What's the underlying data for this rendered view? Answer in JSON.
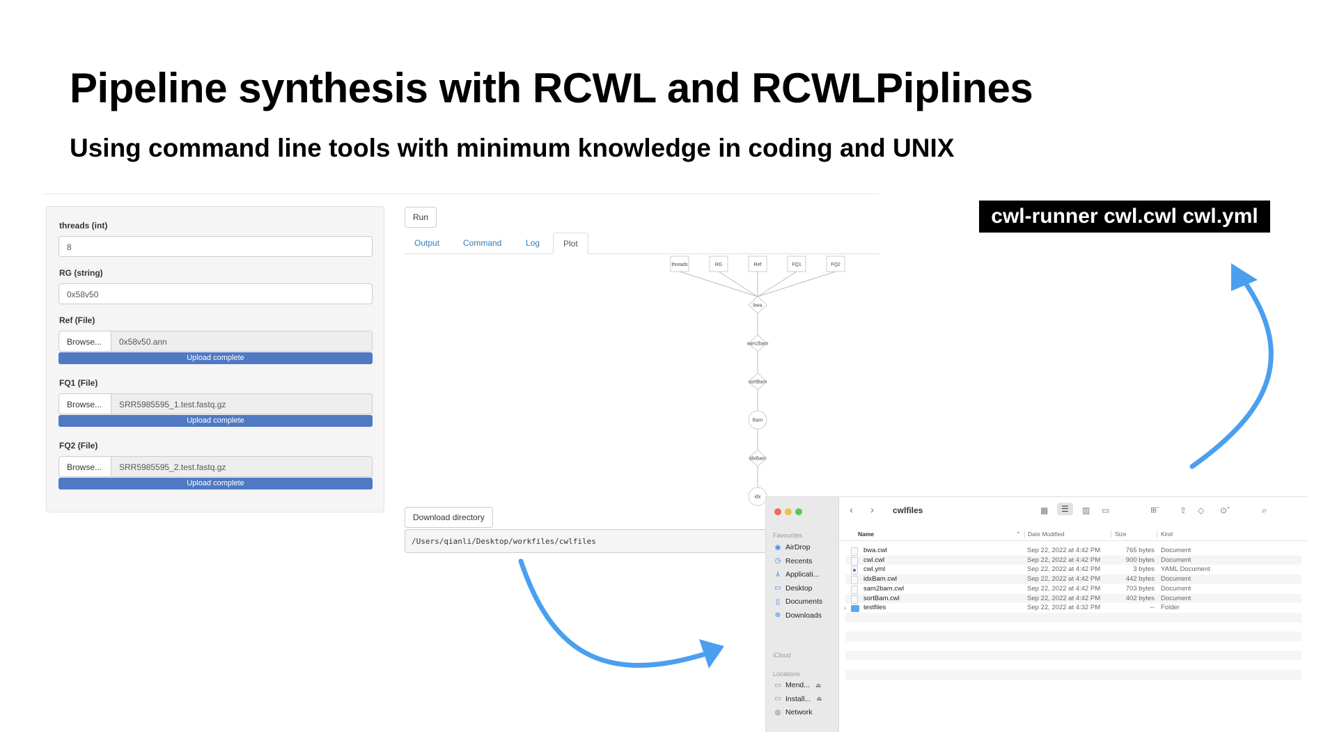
{
  "slide": {
    "title": "Pipeline synthesis with RCWL and RCWLPiplines",
    "subtitle": "Using command line tools with minimum knowledge in coding and UNIX",
    "command": "cwl-runner cwl.cwl cwl.yml"
  },
  "form": {
    "threads": {
      "label": "threads (int)",
      "value": "8"
    },
    "rg": {
      "label": "RG (string)",
      "value": "0x58v50"
    },
    "ref": {
      "label": "Ref (File)",
      "browse": "Browse...",
      "file": "0x58v50.ann",
      "status": "Upload complete"
    },
    "fq1": {
      "label": "FQ1 (File)",
      "browse": "Browse...",
      "file": "SRR5985595_1.test.fastq.gz",
      "status": "Upload complete"
    },
    "fq2": {
      "label": "FQ2 (File)",
      "browse": "Browse...",
      "file": "SRR5985595_2.test.fastq.gz",
      "status": "Upload complete"
    }
  },
  "panel": {
    "run_label": "Run",
    "tabs": [
      "Output",
      "Command",
      "Log",
      "Plot"
    ],
    "active_tab": "Plot",
    "download_label": "Download directory",
    "directory": "/Users/qianli/Desktop/workfiles/cwlfiles"
  },
  "pipeline": {
    "inputs": [
      "threads",
      "RG",
      "Ref",
      "FQ1",
      "FQ2"
    ],
    "steps": [
      "bwa",
      "sam2bam",
      "sortBam",
      "Bam",
      "idxBam",
      "idx"
    ]
  },
  "finder": {
    "folder": "cwlfiles",
    "sidebar": {
      "favourites_header": "Favourites",
      "favourites": [
        {
          "label": "AirDrop",
          "icon": "airdrop-icon"
        },
        {
          "label": "Recents",
          "icon": "clock-icon"
        },
        {
          "label": "Applicati...",
          "icon": "applications-icon"
        },
        {
          "label": "Desktop",
          "icon": "desktop-icon"
        },
        {
          "label": "Documents",
          "icon": "document-icon"
        },
        {
          "label": "Downloads",
          "icon": "download-icon"
        }
      ],
      "icloud_header": "iCloud",
      "locations_header": "Locations",
      "locations": [
        {
          "label": "Mend...",
          "icon": "drive-icon"
        },
        {
          "label": "Install...",
          "icon": "drive-icon"
        },
        {
          "label": "Network",
          "icon": "network-icon"
        }
      ]
    },
    "columns": [
      "Name",
      "Date Modified",
      "Size",
      "Kind"
    ],
    "rows": [
      {
        "name": "bwa.cwl",
        "date": "Sep 22, 2022 at 4:42 PM",
        "size": "765 bytes",
        "kind": "Document",
        "type": "file"
      },
      {
        "name": "cwl.cwl",
        "date": "Sep 22, 2022 at 4:42 PM",
        "size": "900 bytes",
        "kind": "Document",
        "type": "file"
      },
      {
        "name": "cwl.yml",
        "date": "Sep 22, 2022 at 4:42 PM",
        "size": "3 bytes",
        "kind": "YAML Document",
        "type": "yml"
      },
      {
        "name": "idxBam.cwl",
        "date": "Sep 22, 2022 at 4:42 PM",
        "size": "442 bytes",
        "kind": "Document",
        "type": "file"
      },
      {
        "name": "sam2bam.cwl",
        "date": "Sep 22, 2022 at 4:42 PM",
        "size": "703 bytes",
        "kind": "Document",
        "type": "file"
      },
      {
        "name": "sortBam.cwl",
        "date": "Sep 22, 2022 at 4:42 PM",
        "size": "402 bytes",
        "kind": "Document",
        "type": "file"
      },
      {
        "name": "testfiles",
        "date": "Sep 22, 2022 at 4:32 PM",
        "size": "--",
        "kind": "Folder",
        "type": "folder"
      }
    ]
  },
  "colors": {
    "progress": "#5079c3",
    "link": "#337ab7",
    "arrow": "#4a9ff0"
  }
}
